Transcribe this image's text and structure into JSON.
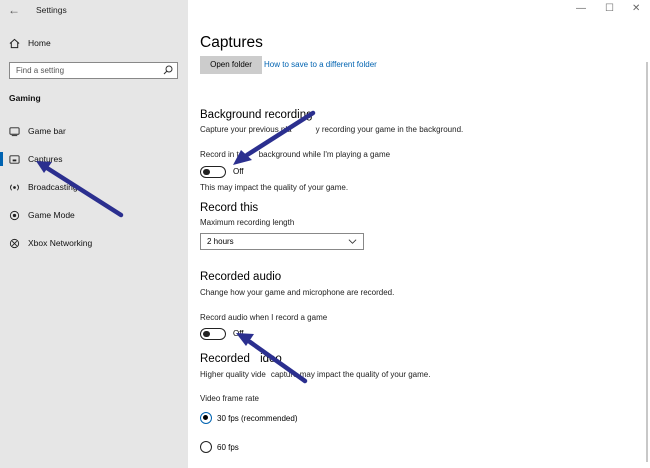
{
  "window": {
    "title": "Settings",
    "back_glyph": "←",
    "minimize_glyph": "—",
    "maximize_glyph": "☐",
    "close_glyph": "✕"
  },
  "sidebar": {
    "home_label": "Home",
    "search_placeholder": "Find a setting",
    "section_title": "Gaming",
    "items": [
      {
        "label": "Game bar",
        "icon": "game-bar-icon",
        "selected": false
      },
      {
        "label": "Captures",
        "icon": "captures-icon",
        "selected": true
      },
      {
        "label": "Broadcasting",
        "icon": "broadcasting-icon",
        "selected": false
      },
      {
        "label": "Game Mode",
        "icon": "game-mode-icon",
        "selected": false
      },
      {
        "label": "Xbox Networking",
        "icon": "xbox-icon",
        "selected": false
      }
    ]
  },
  "main": {
    "title": "Captures",
    "open_folder_label": "Open folder",
    "save_folder_link": "How to save to a different folder",
    "background": {
      "heading": "Background recording",
      "description": "Capture your previous pla",
      "description_tail": "y recording your game in the background.",
      "toggle_label_start": "Record in t",
      "toggle_label_end": "background while I'm playing a game",
      "toggle_state": "Off",
      "note": "This may impact the quality of your game."
    },
    "record_this": {
      "heading": "Record this",
      "subheading": "Maximum recording length",
      "value": "2 hours"
    },
    "audio": {
      "heading": "Recorded audio",
      "description": "Change how your game and microphone are recorded.",
      "toggle_label": "Record audio when I record a game",
      "toggle_state": "Off"
    },
    "video": {
      "heading_start": "Recorded ",
      "heading_end": "ideo",
      "description_start": "Higher quality vide",
      "description_end": "capture may impact the quality of your game.",
      "frame_rate_label": "Video frame rate",
      "options": [
        {
          "label": "30 fps (recommended)",
          "checked": true
        },
        {
          "label": "60 fps",
          "checked": false
        }
      ]
    }
  },
  "colors": {
    "accent": "#0063b1",
    "sidebar_bg": "#e6e6e6",
    "annotation_arrow": "#2b2f8f"
  }
}
